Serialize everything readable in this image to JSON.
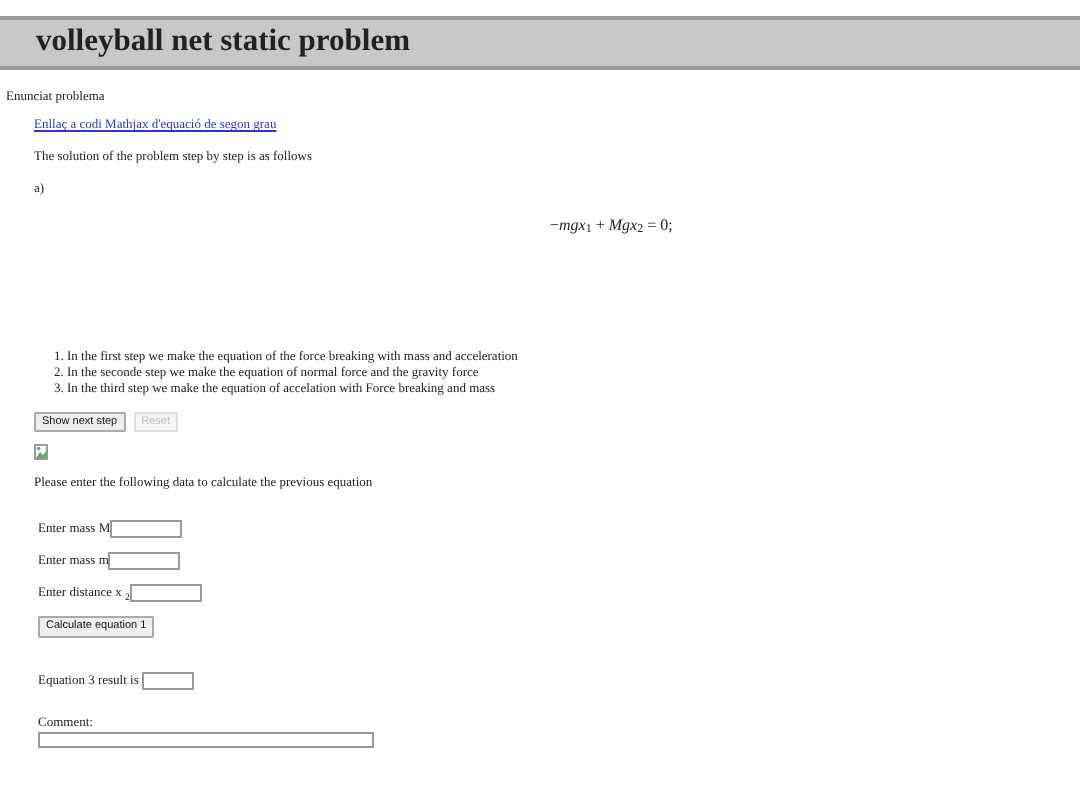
{
  "title": "volleyball net static problem",
  "statement_label": "Enunciat problema",
  "link": "Enllaç a codi Mathjax d'equació de segon grau",
  "intro": "The solution of the problem step by step is as follows",
  "part_label": "a)",
  "equation": "−*mgx*$_{1}$ + *Mgx*$_{2}$ = 0;",
  "steps": [
    {
      "number": "1.",
      "text": "In the first step we make the equation of the force breaking with mass and acceleration"
    },
    {
      "number": "2.",
      "text": "In the seconde step we make the equation of normal force and the gravity force"
    },
    {
      "number": "3.",
      "text": "In the third step we make the equation of accelation with Force breaking and mass"
    }
  ],
  "step_buttons": [
    {
      "label": "Show next step",
      "disabled": false
    },
    {
      "label": "Reset",
      "disabled": true
    }
  ],
  "data_prompt": "Please enter the following data to calculate the previous equation",
  "fields": [
    {
      "label": "Enter mass M"
    },
    {
      "label": "Enter mass m"
    },
    {
      "label": "Enter distance x $_{2}$"
    }
  ],
  "calculate_button": "Calculate equation 1",
  "result_label": "Equation 3 result is",
  "comment_label": "Comment:"
}
